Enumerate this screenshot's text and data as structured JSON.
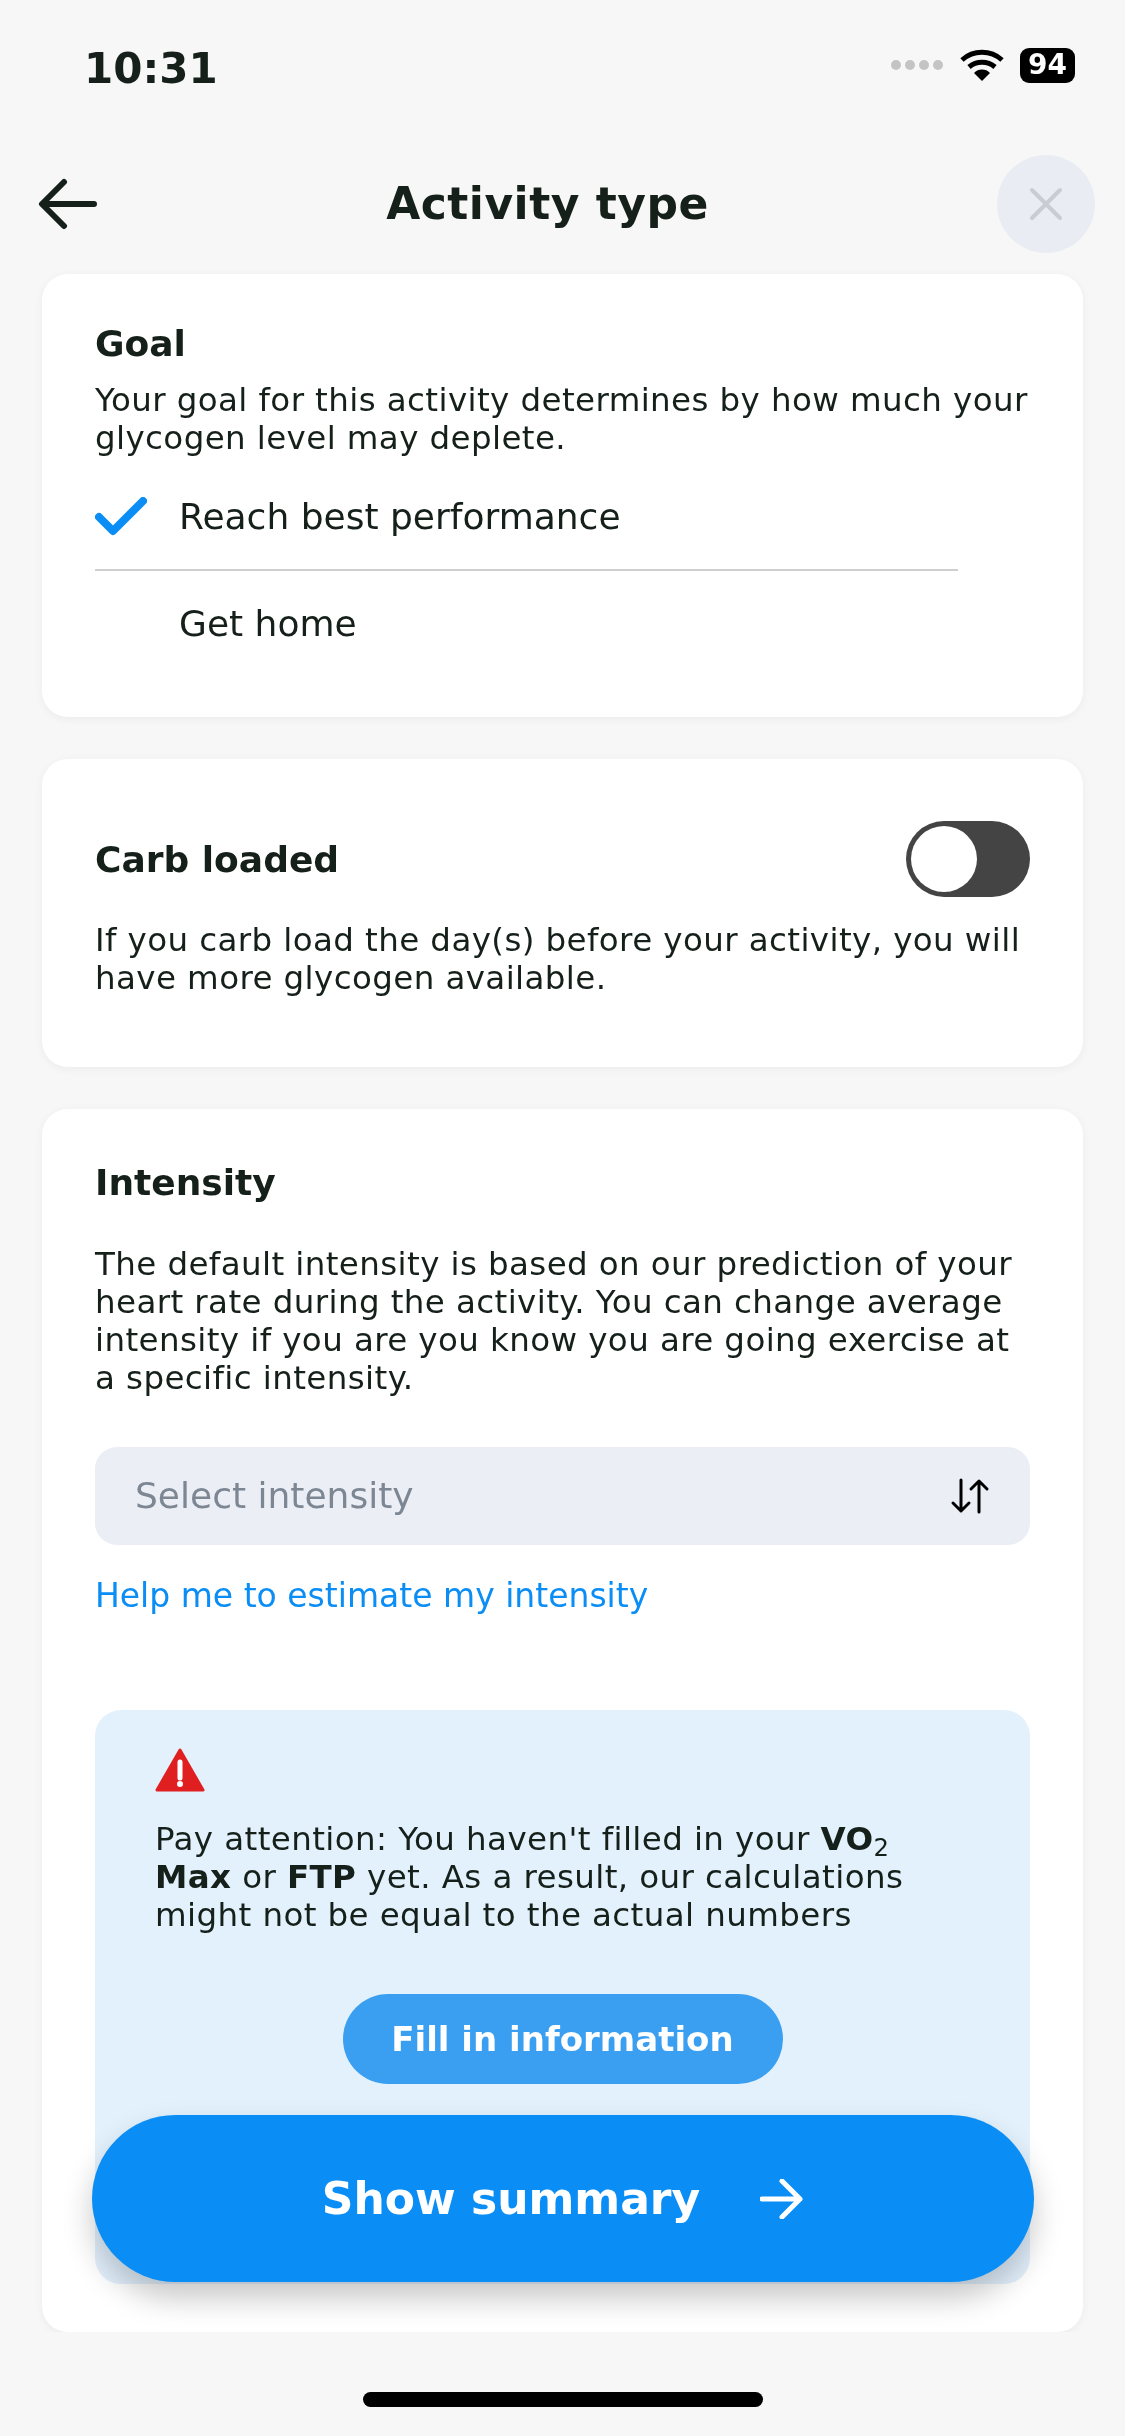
{
  "status_bar": {
    "time": "10:31",
    "battery": "94"
  },
  "header": {
    "title": "Activity type"
  },
  "goal": {
    "title": "Goal",
    "description": "Your goal for this activity determines by how much your glycogen level may deplete.",
    "options": [
      {
        "label": "Reach best performance",
        "selected": true
      },
      {
        "label": "Get home",
        "selected": false
      }
    ]
  },
  "carb_loaded": {
    "title": "Carb loaded",
    "on": false,
    "description": "If you carb load the day(s) before your activity, you will have more glycogen available."
  },
  "intensity": {
    "title": "Intensity",
    "description": "The default intensity is based on our prediction of your heart rate during the activity. You can change average intensity if you are you know you are going exercise at a specific intensity.",
    "select": {
      "placeholder": "Select intensity"
    },
    "help_link": "Help me to estimate my intensity",
    "alert": {
      "text": "Pay attention: You haven't filled in your **VO**$_{2}$ **Max** or **FTP** yet. As a result, our calculations might not be equal to the actual numbers",
      "button": "Fill in information"
    }
  },
  "primary_button": "Show summary"
}
